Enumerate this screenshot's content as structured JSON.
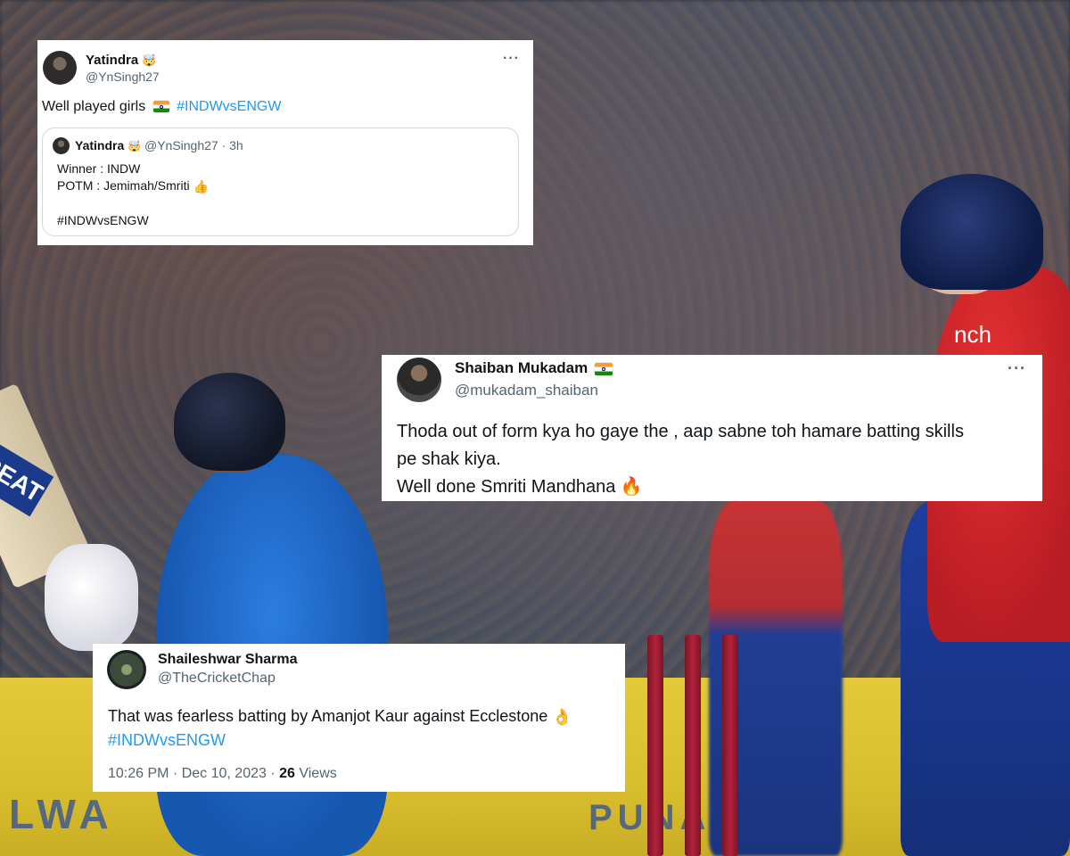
{
  "tweet1": {
    "name": "Yatindra",
    "name_emoji": "🤯",
    "handle": "@YnSingh27",
    "more": "···",
    "text": "Well played girls",
    "hashtag": "#INDWvsENGW",
    "quote": {
      "name": "Yatindra",
      "name_emoji": "🤯",
      "handle": "@YnSingh27",
      "time": "· 3h",
      "line1": "Winner : INDW",
      "line2": "POTM : Jemimah/Smriti",
      "line2_emoji": "👍",
      "hashtag": "#INDWvsENGW"
    }
  },
  "tweet2": {
    "name": "Shaiban Mukadam",
    "handle": "@mukadam_shaiban",
    "more": "···",
    "line1": "Thoda out of form kya ho gaye the , aap sabne toh hamare batting skills",
    "line2": "pe shak kiya.",
    "line3": "Well done Smriti Mandhana",
    "line3_emoji": "🔥"
  },
  "tweet3": {
    "name": "Shaileshwar Sharma",
    "handle": "@TheCricketChap",
    "text": "That was fearless batting by Amanjot Kaur against Ecclestone",
    "text_emoji": "👌",
    "hashtag": "#INDWvsENGW",
    "meta": "10:26 PM · Dec 10, 2023 ·",
    "views_count": "26",
    "views_label": "Views"
  },
  "background": {
    "bat_label": "CEAT",
    "banner_left": "LWA",
    "banner_right": "PUNAGA HI",
    "jersey_red": "nch"
  }
}
